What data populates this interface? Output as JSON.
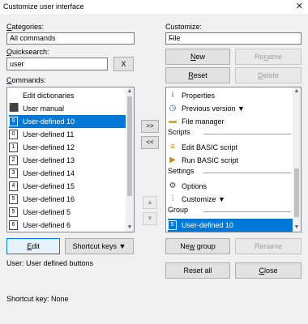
{
  "window": {
    "title": "Customize user interface",
    "close": "✕"
  },
  "left": {
    "categories_label": "Categories:",
    "categories_value": "All commands",
    "quicksearch_label": "Quicksearch:",
    "quicksearch_value": "user",
    "clear_button": "X",
    "commands_label": "Commands:",
    "commands": [
      {
        "label": "Edit dictionaries",
        "icon": "none",
        "badge": ""
      },
      {
        "label": "User manual",
        "icon": "pdf-icon",
        "badge": ""
      },
      {
        "label": "User-defined 10",
        "icon": "number-icon",
        "badge": "9",
        "selected": true
      },
      {
        "label": "User-defined 11",
        "icon": "number-icon",
        "badge": "0"
      },
      {
        "label": "User-defined 12",
        "icon": "number-icon",
        "badge": "1"
      },
      {
        "label": "User-defined 13",
        "icon": "number-icon",
        "badge": "2"
      },
      {
        "label": "User-defined 14",
        "icon": "number-icon",
        "badge": "3"
      },
      {
        "label": "User-defined 15",
        "icon": "number-icon",
        "badge": "4"
      },
      {
        "label": "User-defined 16",
        "icon": "number-icon",
        "badge": "5"
      },
      {
        "label": "User-defined 5",
        "icon": "number-icon",
        "badge": "5"
      },
      {
        "label": "User-defined 6",
        "icon": "number-icon",
        "badge": "6"
      }
    ],
    "edit_button": "Edit",
    "shortcut_keys_button": "Shortcut keys ▼",
    "description": "User: User defined buttons",
    "shortcut_key": "Shortcut key: None"
  },
  "middle": {
    "add_button": ">>",
    "remove_button": "<<",
    "up": "▲",
    "down": "▼"
  },
  "right": {
    "customize_label": "Customize:",
    "customize_value": "File",
    "new_button": "New",
    "rename_button": "Rename",
    "reset_button": "Reset",
    "delete_button": "Delete",
    "items": [
      {
        "kind": "item",
        "label": "Properties",
        "icon": "info-icon"
      },
      {
        "kind": "item",
        "label": "Previous version ▼",
        "icon": "clock-icon"
      },
      {
        "kind": "item",
        "label": "File manager",
        "icon": "folder-icon"
      },
      {
        "kind": "sep",
        "label": "Scripts"
      },
      {
        "kind": "item",
        "label": "Edit BASIC script",
        "icon": "script-icon"
      },
      {
        "kind": "item",
        "label": "Run BASIC script",
        "icon": "run-icon"
      },
      {
        "kind": "sep",
        "label": "Settings"
      },
      {
        "kind": "item",
        "label": "Options",
        "icon": "gear-icon"
      },
      {
        "kind": "item",
        "label": "Customize ▼",
        "icon": "sliders-icon"
      },
      {
        "kind": "sep",
        "label": "Group"
      },
      {
        "kind": "item",
        "label": "User-defined 10",
        "icon": "number-icon",
        "badge": "9",
        "selected": true
      }
    ],
    "new_group_button": "New group",
    "rename_group_button": "Rename",
    "reset_all_button": "Reset all",
    "close_button": "Close"
  }
}
